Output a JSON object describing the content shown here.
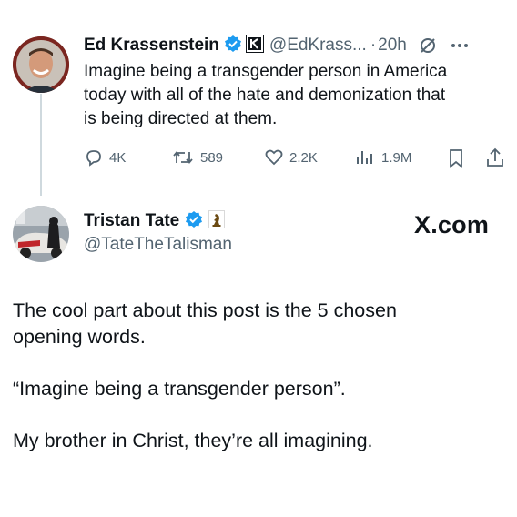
{
  "tweet": {
    "display_name": "Ed Krassenstein",
    "handle": "@EdKrass...",
    "separator": "·",
    "time": "20h",
    "text_lines": [
      "Imagine being a transgender person in America",
      "today with all of the hate and demonization that",
      "is being directed at them."
    ],
    "actions": {
      "replies": "4K",
      "reposts": "589",
      "likes": "2.2K",
      "views": "1.9M"
    }
  },
  "reply": {
    "display_name": "Tristan Tate",
    "handle": "@TateTheTalisman",
    "watermark": "X.com",
    "paragraphs": [
      "The cool part about this post is the 5 chosen",
      "opening words.",
      "“Imagine being a transgender person”.",
      "My brother in Christ, they’re all imagining."
    ]
  },
  "colors": {
    "verified": "#1d9bf0",
    "muted": "#536471",
    "text": "#0f1419"
  },
  "icons": [
    "verified-badge-icon",
    "affiliate-k-icon",
    "grok-icon",
    "more-icon",
    "reply-icon",
    "repost-icon",
    "like-icon",
    "views-icon",
    "bookmark-icon",
    "share-icon",
    "chess-piece-icon"
  ]
}
